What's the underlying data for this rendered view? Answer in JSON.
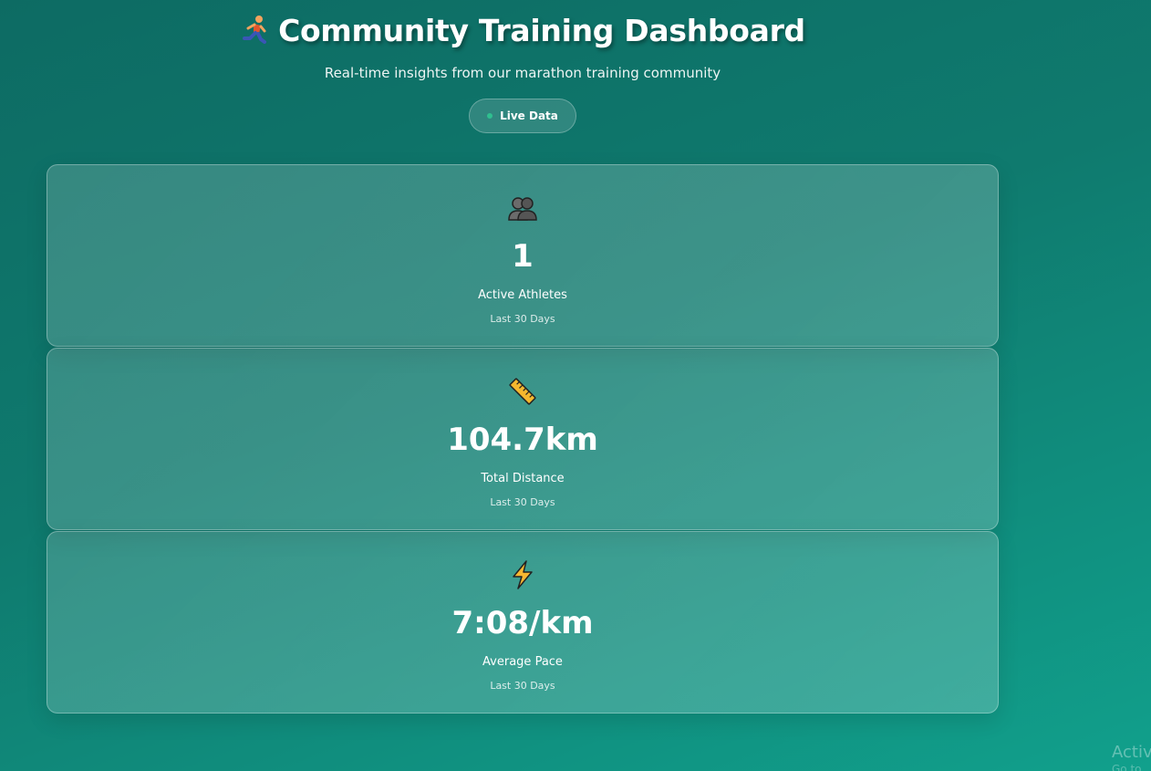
{
  "header": {
    "title": "Community Training Dashboard",
    "subtitle": "Real-time insights from our marathon training community",
    "live_badge": "Live Data",
    "title_icon": "runner-icon"
  },
  "stats": [
    {
      "icon": "two-people-icon",
      "value": "1",
      "label": "Active Athletes",
      "period": "Last 30 Days"
    },
    {
      "icon": "ruler-icon",
      "value": "104.7km",
      "label": "Total Distance",
      "period": "Last 30 Days"
    },
    {
      "icon": "lightning-icon",
      "value": "7:08/km",
      "label": "Average Pace",
      "period": "Last 30 Days"
    }
  ],
  "watermark": {
    "line1": "Activ",
    "line2": "Go to"
  },
  "colors": {
    "background_start": "#0d6b63",
    "background_end": "#11a08c",
    "live_dot": "#2fbf8f"
  }
}
